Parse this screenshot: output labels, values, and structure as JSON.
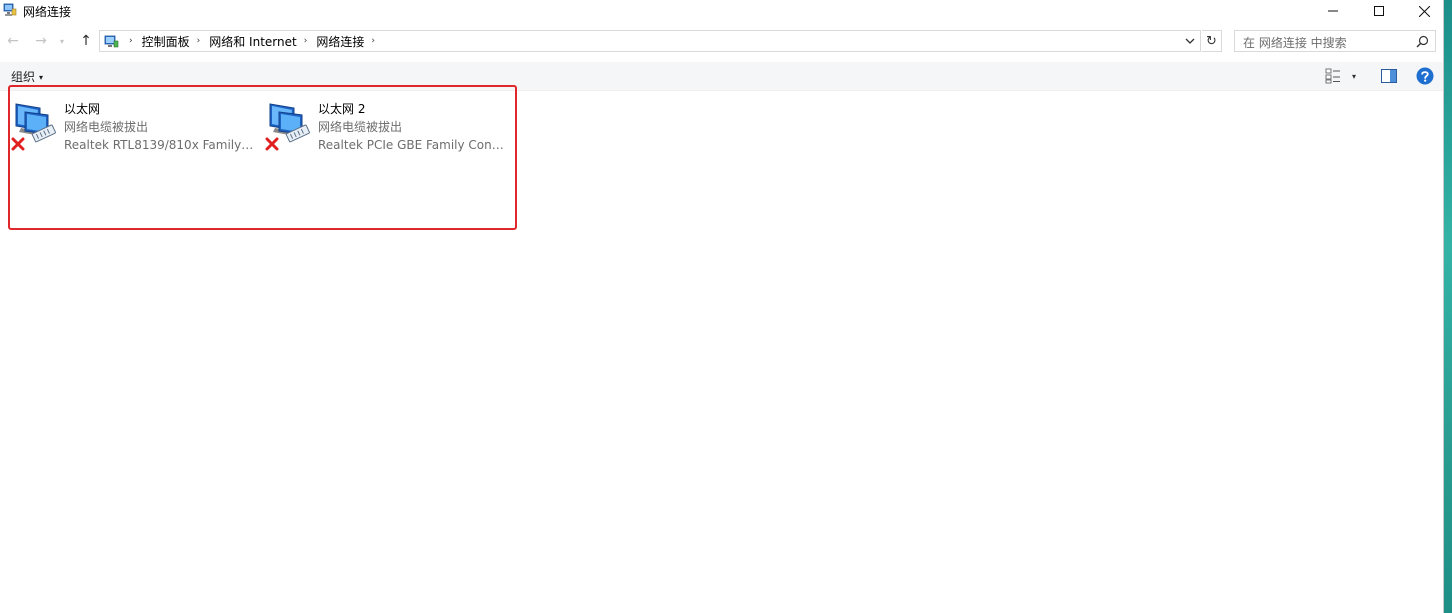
{
  "window": {
    "title": "网络连接",
    "icon": "network-connections-icon",
    "controls": [
      "minimize-icon",
      "maximize-icon",
      "close-icon"
    ]
  },
  "navigation": {
    "back": "←",
    "forward": "→",
    "recent": "▾",
    "up": "↑",
    "refresh": "↻",
    "breadcrumb": [
      "控制面板",
      "网络和 Internet",
      "网络连接"
    ],
    "separator": "›"
  },
  "search": {
    "placeholder": "在 网络连接 中搜索"
  },
  "toolbar": {
    "organize_label": "组织",
    "organize_caret": "▾",
    "view_caret": "▾"
  },
  "adapters": [
    {
      "name": "以太网",
      "status": "网络电缆被拔出",
      "device": "Realtek RTL8139/810x Family F...",
      "state_icon": "disconnected-x-icon"
    },
    {
      "name": "以太网 2",
      "status": "网络电缆被拔出",
      "device": "Realtek PCIe GBE Family Contr...",
      "state_icon": "disconnected-x-icon"
    }
  ],
  "colors": {
    "highlight": "#e0272b",
    "secondary_text": "#6d6d6d",
    "help_blue": "#1f6fd1",
    "disconnected_red": "#e02020"
  }
}
